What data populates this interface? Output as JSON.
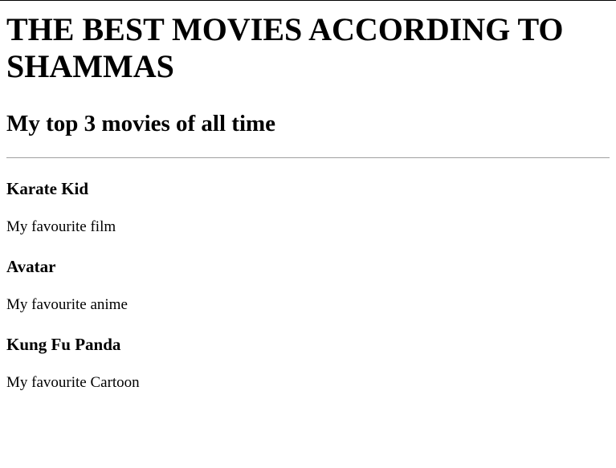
{
  "page": {
    "heading": "THE BEST MOVIES ACCORDING TO SHAMMAS",
    "subheading": "My top 3 movies of all time"
  },
  "movies": [
    {
      "title": "Karate Kid",
      "description": "My favourite film"
    },
    {
      "title": "Avatar",
      "description": "My favourite anime"
    },
    {
      "title": "Kung Fu Panda",
      "description": "My favourite Cartoon"
    }
  ]
}
